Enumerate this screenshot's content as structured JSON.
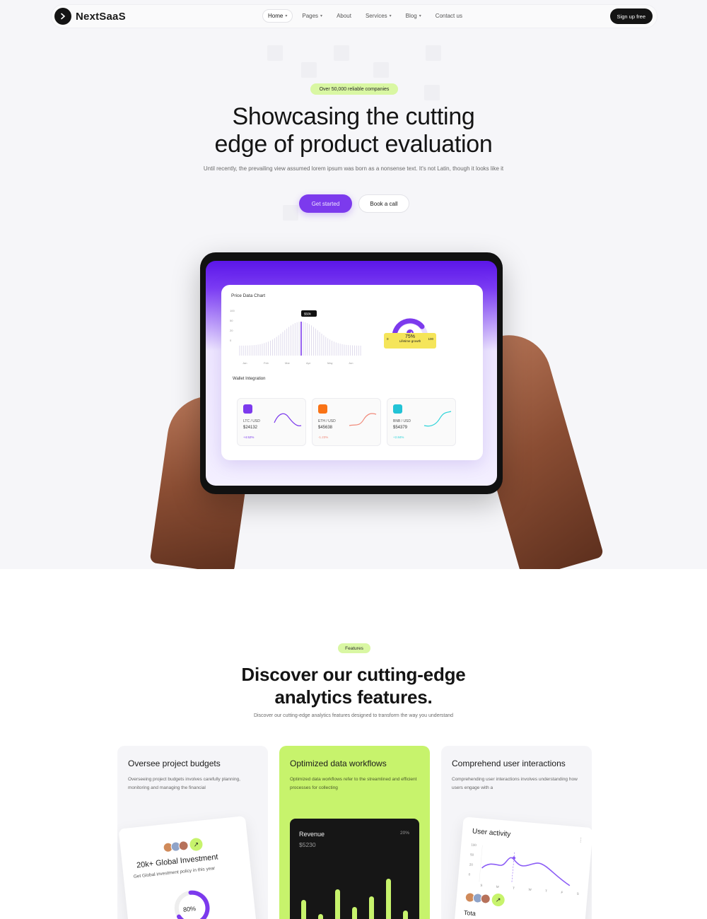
{
  "nav": {
    "logo_text": "NextSaaS",
    "links": [
      "Home",
      "Pages",
      "About",
      "Services",
      "Blog",
      "Contact us"
    ],
    "signup_label": "Sign up free"
  },
  "hero": {
    "badge": "Over 50,000 reliable companies",
    "title_line1": "Showcasing the cutting",
    "title_line2": "edge of product evaluation",
    "subtitle": "Until recently, the prevailing view assumed lorem ipsum was born as a nonsense text. It's not Latin, though it looks like it",
    "primary_cta": "Get started",
    "secondary_cta": "Book a call"
  },
  "dashboard": {
    "chart_title": "Price Data Chart",
    "tooltip": "$50k",
    "y_ticks": [
      "100",
      "50",
      "20",
      "0"
    ],
    "x_ticks": [
      "Jan",
      "Feb",
      "Mar",
      "Apr",
      "May",
      "Jun"
    ],
    "gauge_value": "75%",
    "gauge_caption": "Lifetime growth",
    "gauge_min": "0",
    "gauge_max": "100",
    "wallet_title": "Wallet Integration",
    "wallets": [
      {
        "pair": "LTC / USD",
        "value": "$24132",
        "change": "+4.52%",
        "color": "#7c3aed",
        "line": "#7c3aed"
      },
      {
        "pair": "ETH / USD",
        "value": "$45638",
        "change": "-1.23%",
        "color": "#f97316",
        "line": "#f08a7a"
      },
      {
        "pair": "BNB / USD",
        "value": "$54379",
        "change": "+2.84%",
        "color": "#22c3d6",
        "line": "#2ad3d8"
      }
    ]
  },
  "features": {
    "badge": "Features",
    "title_line1": "Discover our cutting-edge",
    "title_line2": "analytics features.",
    "subtitle": "Discover our cutting-edge analytics features designed to transform the way you understand",
    "cards": [
      {
        "title": "Oversee project budgets",
        "desc": "Overseeing project budgets involves carefully planning, monitoring and managing the financial"
      },
      {
        "title": "Optimized data workflows",
        "desc": "Optimized data workflows refer to the streamlined and efficient processes for collecting"
      },
      {
        "title": "Comprehend user interactions",
        "desc": "Comprehending user interactions involves understanding how users engage with a"
      }
    ],
    "invest": {
      "title": "20k+ Global Investment",
      "desc": "Get Global investment policy in this year",
      "percent": "80%"
    },
    "revenue": {
      "label": "Revenue",
      "value": "$5230",
      "pct": "20%",
      "bars": [
        0.55,
        0.35,
        0.7,
        0.45,
        0.6,
        0.85,
        0.4
      ]
    },
    "activity": {
      "title": "User activity",
      "y_ticks": [
        "100",
        "50",
        "20",
        "0"
      ],
      "x_ticks": [
        "S",
        "M",
        "T",
        "W",
        "T",
        "F",
        "S"
      ],
      "footer": "Tota"
    }
  },
  "colors": {
    "accent": "#7c3aed",
    "lime": "#c7f36c",
    "lime_badge": "#d9f7a3",
    "dark": "#141414"
  }
}
